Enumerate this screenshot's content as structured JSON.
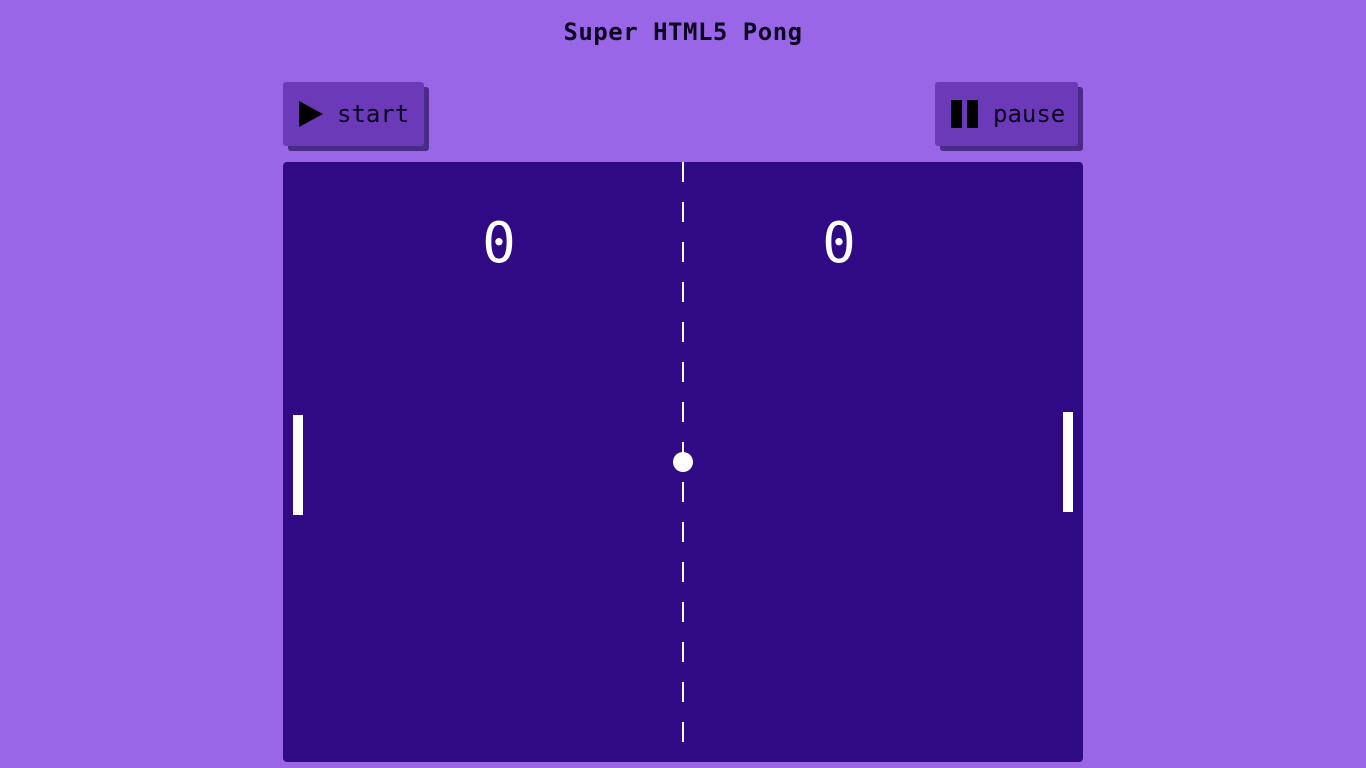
{
  "title": "Super HTML5 Pong",
  "controls": {
    "start_label": "start",
    "start_icon": "play-icon",
    "pause_label": "pause",
    "pause_icon": "pause-icon"
  },
  "score": {
    "left": "0",
    "right": "0"
  },
  "colors": {
    "background": "#9966e8",
    "button": "#6a3ab8",
    "court": "#300a84",
    "foreground": "#ffffff"
  }
}
